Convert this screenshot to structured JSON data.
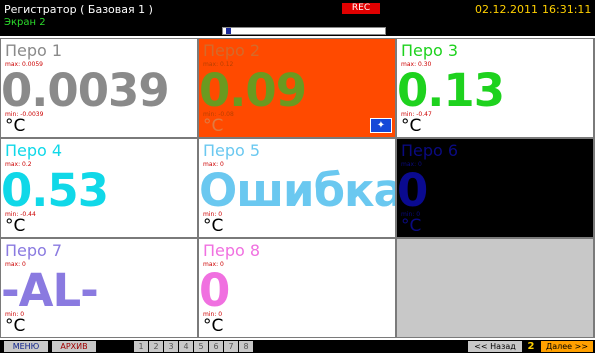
{
  "header": {
    "title": "Регистратор ( Базовая 1 )",
    "screen_label": "Экран 2",
    "rec_label": "REC",
    "date": "02.12.2011",
    "time": "16:31:11",
    "progress_fraction": 0.02
  },
  "channels": [
    {
      "name": "Перо 1",
      "max": "max: 0.0059",
      "value": "0.0039",
      "min": "min: -0.0039",
      "unit": "°C",
      "bg": "#ffffff",
      "name_color": "#8a8a8a",
      "value_color": "#8a8a8a",
      "label_color": "#cc0000",
      "unit_color": "#000000"
    },
    {
      "name": "Перо 2",
      "max": "max: 0.12",
      "value": "0.09",
      "min": "min: -0.08",
      "unit": "°C",
      "bg": "#ff4a00",
      "name_color": "#d46a2a",
      "value_color": "#6a9a20",
      "label_color": "#b84000",
      "unit_color": "#e07a40",
      "icon": "expand-icon"
    },
    {
      "name": "Перо 3",
      "max": "max: 0.30",
      "value": "0.13",
      "min": "min: -0.47",
      "unit": "°C",
      "bg": "#ffffff",
      "name_color": "#1ed21e",
      "value_color": "#1ed21e",
      "label_color": "#cc0000",
      "unit_color": "#000000"
    },
    {
      "name": "Перо 4",
      "max": "max: 0.2",
      "value": "0.53",
      "min": "min: -0.44",
      "unit": "°C",
      "bg": "#ffffff",
      "name_color": "#10d8e8",
      "value_color": "#10d8e8",
      "label_color": "#cc0000",
      "unit_color": "#000000"
    },
    {
      "name": "Перо 5",
      "max": "max: 0",
      "value": "Ошибка",
      "min": "min: 0",
      "unit": "°C",
      "bg": "#ffffff",
      "name_color": "#6ac8f0",
      "value_color": "#6ac8f0",
      "label_color": "#cc0000",
      "unit_color": "#000000"
    },
    {
      "name": "Перо 6",
      "max": "max: 0",
      "value": "0",
      "min": "min: 0",
      "unit": "°C",
      "bg": "#000000",
      "name_color": "#0a0a80",
      "value_color": "#0a0a90",
      "label_color": "#0a0a80",
      "unit_color": "#0a0a80"
    },
    {
      "name": "Перо 7",
      "max": "max: 0",
      "value": "-AL-",
      "min": "min: 0",
      "unit": "°C",
      "bg": "#ffffff",
      "name_color": "#8a7ae0",
      "value_color": "#8a7ae0",
      "label_color": "#cc0000",
      "unit_color": "#000000"
    },
    {
      "name": "Перо 8",
      "max": "max: 0",
      "value": "0",
      "min": "min: 0",
      "unit": "°C",
      "bg": "#ffffff",
      "name_color": "#f070e0",
      "value_color": "#f070e0",
      "label_color": "#cc0000",
      "unit_color": "#000000"
    }
  ],
  "footer": {
    "menu_label": "МЕНЮ",
    "archive_label": "АРХИВ",
    "pages": [
      "1",
      "2",
      "3",
      "4",
      "5",
      "6",
      "7",
      "8"
    ],
    "back_label": "<< Назад",
    "current_page": "2",
    "next_label": "Далее >>"
  }
}
